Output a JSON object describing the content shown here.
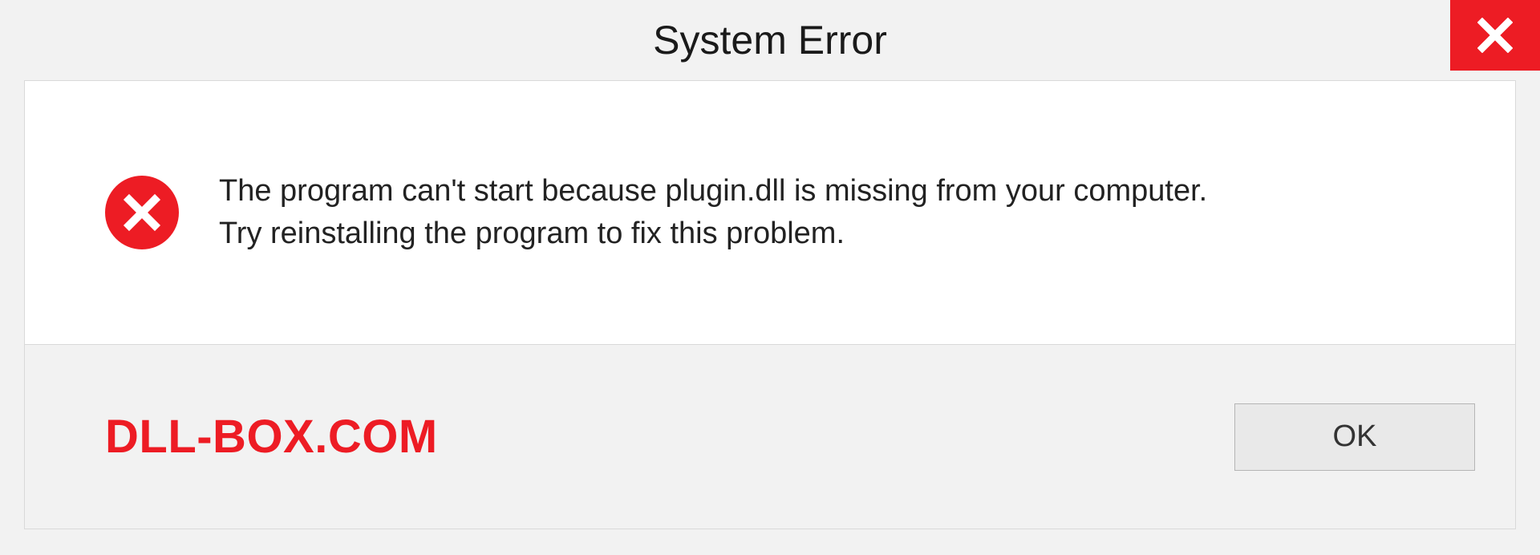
{
  "titlebar": {
    "title": "System Error"
  },
  "content": {
    "message_line1": "The program can't start because plugin.dll is missing from your computer.",
    "message_line2": "Try reinstalling the program to fix this problem."
  },
  "footer": {
    "watermark": "DLL-BOX.COM",
    "ok_label": "OK"
  },
  "colors": {
    "accent_red": "#ed1c24",
    "bg_gray": "#f2f2f2",
    "border": "#d9d9d9"
  }
}
